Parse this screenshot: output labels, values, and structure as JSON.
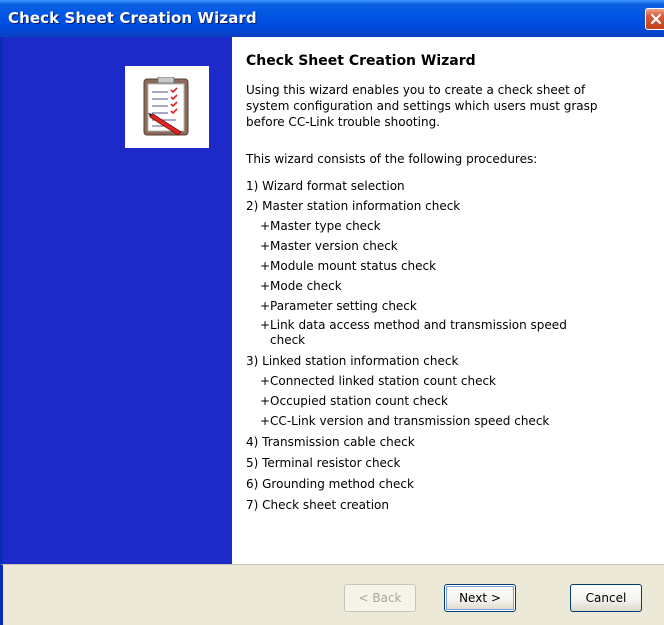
{
  "window": {
    "title": "Check Sheet Creation Wizard"
  },
  "colors": {
    "titlebar": "#0055e5",
    "leftpane": "#1c2ac9",
    "close_button": "#d95a36",
    "footer": "#ece9d8"
  },
  "icons": {
    "wizard_icon": "clipboard-checklist-icon",
    "close_icon": "close-icon"
  },
  "content": {
    "heading": "Check Sheet Creation Wizard",
    "intro": "Using this wizard enables you to create a check sheet of system configuration and settings which users must grasp before CC-Link trouble shooting.",
    "subtitle": "This wizard consists of the following procedures:",
    "steps": [
      {
        "label": "1) Wizard format selection",
        "subs": []
      },
      {
        "label": "2) Master station information check",
        "subs": [
          "+Master type check",
          "+Master version check",
          "+Module mount status check",
          "+Mode check",
          "+Parameter setting check"
        ]
      },
      {
        "label": "3) Linked station information check",
        "subs": [
          "+Connected linked station count check",
          "+Occupied station count check",
          "+CC-Link version and transmission speed check"
        ]
      },
      {
        "label": "4) Transmission cable check",
        "subs": []
      },
      {
        "label": "5) Terminal resistor check",
        "subs": []
      },
      {
        "label": "6) Grounding method check",
        "subs": []
      },
      {
        "label": "7) Check sheet creation",
        "subs": []
      }
    ],
    "wrapped_sub": {
      "line1": "+Link data access method and transmission speed",
      "line2": "check"
    }
  },
  "buttons": {
    "back": "< Back",
    "next": "Next >",
    "cancel": "Cancel"
  }
}
